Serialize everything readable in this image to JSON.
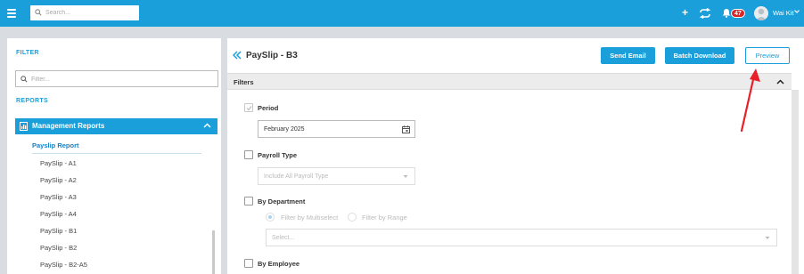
{
  "topbar": {
    "search_placeholder": "Search...",
    "notification_count": "47",
    "user_name": "Wai Kit",
    "brand_color": "#1a9fdb",
    "icons": [
      "menu-icon",
      "search-icon",
      "plus-icon",
      "sync-icon",
      "bell-icon",
      "avatar",
      "chevron-down-icon"
    ]
  },
  "sidebar": {
    "filter_title": "FILTER",
    "filter_placeholder": "Filter...",
    "reports_title": "REPORTS",
    "group_label": "Management Reports",
    "sub_label": "Payslip Report",
    "items": [
      "PaySlip - A1",
      "PaySlip - A2",
      "PaySlip - A3",
      "PaySlip - A4",
      "PaySlip - B1",
      "PaySlip - B2",
      "PaySlip - B2-A5"
    ]
  },
  "main": {
    "title": "PaySlip - B3",
    "buttons": {
      "send_email": "Send Email",
      "batch_download": "Batch Download",
      "preview": "Preview"
    },
    "filters_label": "Filters",
    "period": {
      "label": "Period",
      "checked": true,
      "value": "February 2025"
    },
    "payroll_type": {
      "label": "Payroll Type",
      "checked": false,
      "placeholder": "Include All Payroll Type"
    },
    "by_department": {
      "label": "By Department",
      "checked": false,
      "radio_multiselect": "Filter by Multiselect",
      "radio_range": "Filter by Range",
      "select_placeholder": "Select..."
    },
    "by_employee": {
      "label": "By Employee",
      "checked": false
    }
  },
  "annotation_color": "#e8202a"
}
